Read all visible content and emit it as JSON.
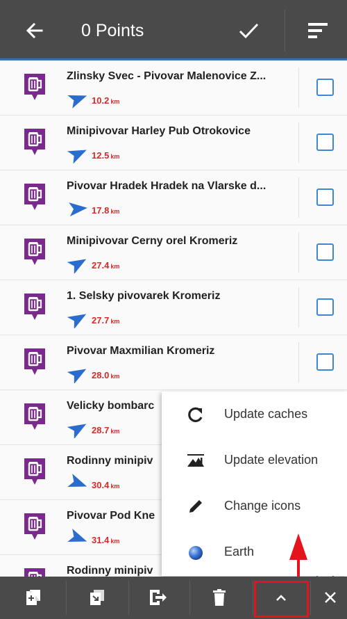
{
  "header": {
    "title": "0 Points",
    "back_icon": "arrow-left-icon",
    "confirm_icon": "checkmark-icon",
    "sort_icon": "sort-lines-icon"
  },
  "points": [
    {
      "name": "Zlinsky Svec - Pivovar Malenovice Z...",
      "distance": "10.2",
      "unit": "km"
    },
    {
      "name": "Minipivovar Harley Pub Otrokovice",
      "distance": "12.5",
      "unit": "km"
    },
    {
      "name": "Pivovar Hradek Hradek na Vlarske d...",
      "distance": "17.8",
      "unit": "km"
    },
    {
      "name": "Minipivovar Cerny orel Kromeriz",
      "distance": "27.4",
      "unit": "km"
    },
    {
      "name": "1. Selsky pivovarek Kromeriz",
      "distance": "27.7",
      "unit": "km"
    },
    {
      "name": "Pivovar Maxmilian Kromeriz",
      "distance": "28.0",
      "unit": "km"
    },
    {
      "name": "Velicky bombarc",
      "distance": "28.7",
      "unit": "km"
    },
    {
      "name": "Rodinny minipiv",
      "distance": "30.4",
      "unit": "km"
    },
    {
      "name": "Pivovar Pod Kne",
      "distance": "31.4",
      "unit": "km"
    },
    {
      "name": "Rodinny minipiv",
      "distance": "",
      "unit": ""
    }
  ],
  "menu": {
    "items": [
      {
        "label": "Update caches",
        "icon": "refresh-icon"
      },
      {
        "label": "Update elevation",
        "icon": "elevation-icon"
      },
      {
        "label": "Change icons",
        "icon": "pencil-icon"
      },
      {
        "label": "Earth",
        "icon": "earth-globe-icon"
      }
    ]
  },
  "toolbar": {
    "buttons": [
      "add-to-folder-icon",
      "move-to-folder-icon",
      "export-icon",
      "delete-icon",
      "chevron-up-icon",
      "close-icon"
    ]
  },
  "colors": {
    "bar": "#4a4a4a",
    "accent": "#3d86d4",
    "poi_purple": "#7a2a8c",
    "distance_red": "#d42a2a",
    "highlight": "#e3141c"
  }
}
